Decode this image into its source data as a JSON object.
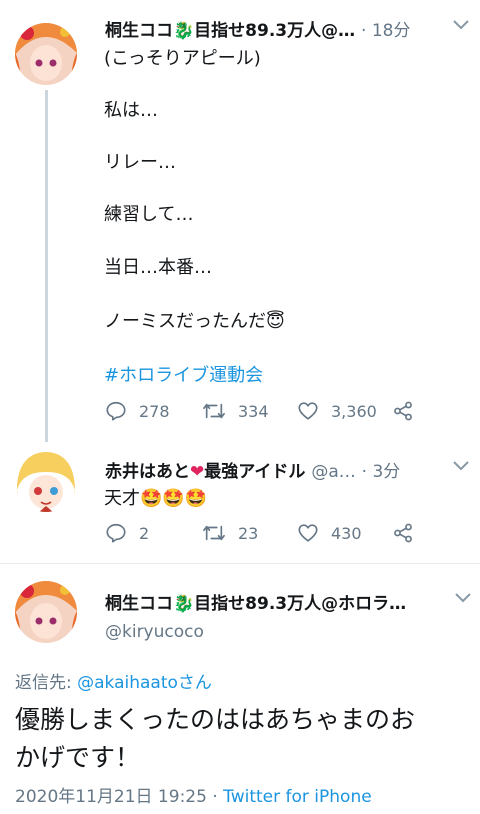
{
  "tweets": [
    {
      "author": "桐生ココ",
      "author_suffix": "目指せ89.3万人@…",
      "time": "· 18分",
      "lines": [
        "(こっそりアピール)",
        "私は…",
        "リレー…",
        "練習して…",
        "当日…本番…",
        "ノーミスだったんだ"
      ],
      "hashtag": "#ホロライブ運動会",
      "replies": "278",
      "retweets": "334",
      "likes": "3,360"
    },
    {
      "author": "赤井はあと",
      "author_suffix": "最強アイドル",
      "handle_short": "@a…",
      "time": "· 3分",
      "text": "天才",
      "replies": "2",
      "retweets": "23",
      "likes": "430"
    }
  ],
  "main_tweet": {
    "author": "桐生ココ",
    "author_suffix": "目指せ89.3万人@ホロラ…",
    "handle": "@kiryucoco",
    "reply_to_label": "返信先:",
    "reply_to_user": "@akaihaatoさん",
    "text_line1": "優勝しまくったのははあちゃまのお",
    "text_line2": "かげです！",
    "timestamp": "2020年11月21日 19:25 ·",
    "client": "Twitter for iPhone"
  },
  "colors": {
    "accent": "#1b95e0",
    "muted": "#657786",
    "text": "#14171a"
  },
  "icons": [
    "reply-icon",
    "retweet-icon",
    "like-icon",
    "share-icon",
    "chevron-down-icon",
    "dragon-emoji",
    "heart-emoji",
    "star-struck-emoji",
    "halo-emoji"
  ]
}
